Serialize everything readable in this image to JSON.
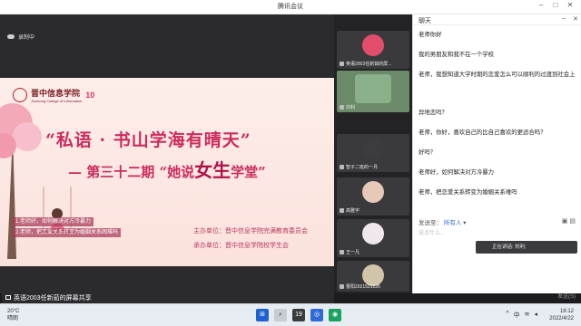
{
  "window": {
    "title": "腾讯会议"
  },
  "share": {
    "recording_label": "录制中",
    "sharer_label": "英语2003任新茹的屏幕共享"
  },
  "slide": {
    "school_name": "晋中信息学院",
    "school_en": "Jinzhong College of Information",
    "anniversary": "10",
    "main_title": "“私语 · 书山学海有晴天”",
    "sub_title_prefix": "— 第三十二期 “她说",
    "sub_title_big": "女生",
    "sub_title_suffix": "学堂”",
    "host_org": "主办单位：晋中信息学院完满教育委员会",
    "organizer_org": "承办单位：晋中信息学院校学生会",
    "caption_1": "1.老师好，如何解决对方冷暴力",
    "caption_2": "2.老师，把恋爱关系转变为婚姻关系困难吗"
  },
  "participants": [
    {
      "name": "英语2003任新茹的屏..."
    },
    {
      "name": "刘利"
    },
    {
      "name": "智子二班的一月"
    },
    {
      "name": "高雅宇"
    },
    {
      "name": "王一凡"
    },
    {
      "name": "曹阳2021521226"
    }
  ],
  "chat": {
    "title": "聊天",
    "messages": [
      "老师你好",
      "我的男朋友和我不在一个学校",
      "老师，我想知道大学时期的恋爱怎么可以顺利的过渡到社会上",
      "异地恋吗？",
      "老师，你好，喜欢自己的比自己喜欢的更适合吗？",
      "好吗？",
      "老师好，如何解决对方冷暴力",
      "老师，把恋爱关系转变为婚姻关系难吗"
    ],
    "send_to_label": "发送至：",
    "send_to_value": "所有人",
    "input_placeholder": "说点什么...",
    "send_button": "发送(S)"
  },
  "speaking": {
    "label": "正在讲话: 刘利;"
  },
  "taskbar": {
    "weather_temp": "20°C",
    "weather_desc": "晴朗",
    "time": "16:12",
    "date": "2022/4/22",
    "lang": "中"
  },
  "colors": {
    "slide_title": "#cc2b5e",
    "chat_bg": "#ffffff",
    "accent_blue": "#2f6bd8"
  }
}
